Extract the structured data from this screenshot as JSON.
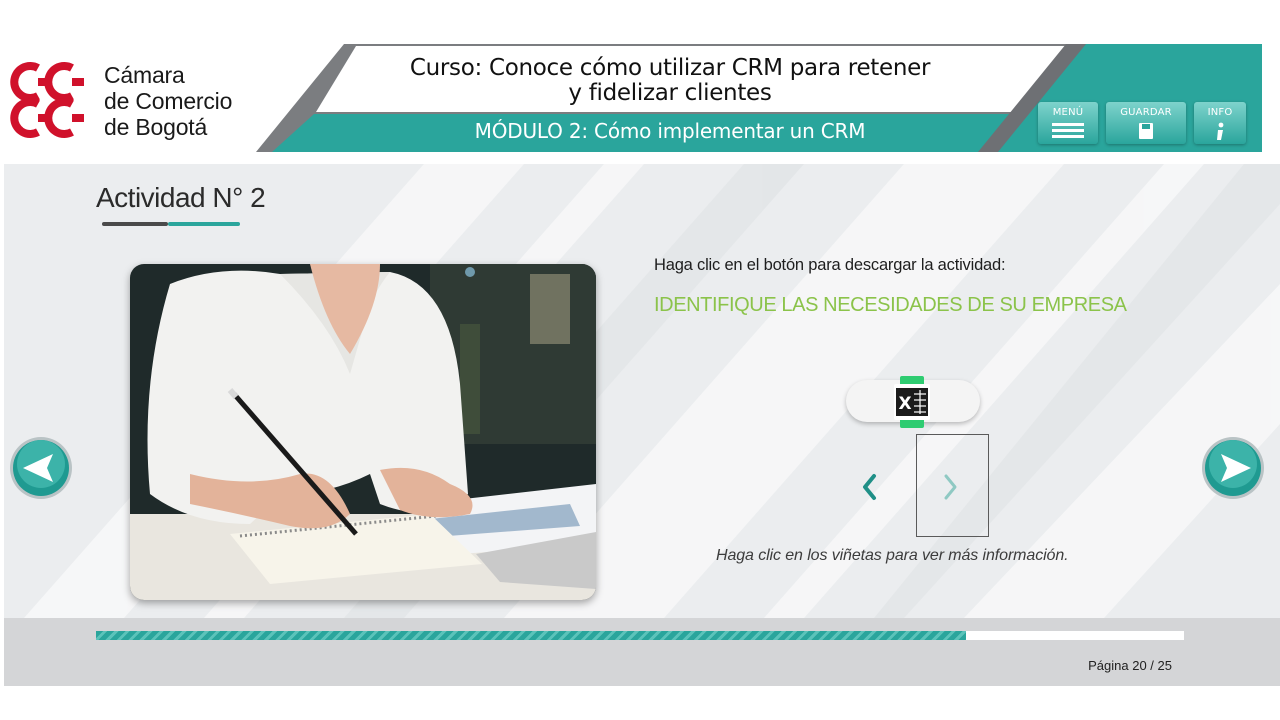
{
  "brand": {
    "name_lines": [
      "Cámara",
      "de Comercio",
      "de Bogotá"
    ],
    "logo_color": "#d0112b"
  },
  "header": {
    "course_title_lines": [
      "Curso: Conoce cómo utilizar CRM para retener",
      "y fidelizar clientes"
    ],
    "module_title": "MÓDULO 2: Cómo implementar un CRM",
    "accent_color": "#2aa59c",
    "buttons": {
      "menu": {
        "label": "MENÚ",
        "icon": "hamburger-icon"
      },
      "save": {
        "label": "GUARDAR",
        "icon": "save-icon"
      },
      "info": {
        "label": "INFO",
        "icon": "info-icon"
      }
    }
  },
  "activity": {
    "title": "Actividad N° 2",
    "instruction": "Haga clic en el botón para descargar la actividad:",
    "name": "IDENTIFIQUE LAS NECESIDADES DE SU EMPRESA",
    "name_color": "#8bc34a",
    "download_icon": "excel-icon",
    "bullets_hint": "Haga clic en los viñetas para ver más información."
  },
  "navigation": {
    "prev_icon": "arrow-left-icon",
    "next_icon": "arrow-right-icon",
    "progress": 0.8
  },
  "footer": {
    "page_label": "Página 20 / 25"
  }
}
